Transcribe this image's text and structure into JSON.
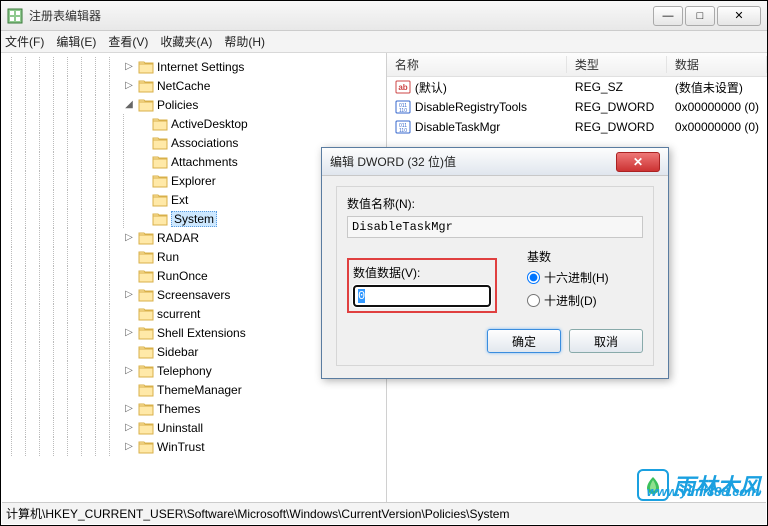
{
  "window": {
    "title": "注册表编辑器",
    "min": "—",
    "max": "□",
    "close": "✕"
  },
  "menu": {
    "file": "文件(F)",
    "edit": "编辑(E)",
    "view": "查看(V)",
    "favorites": "收藏夹(A)",
    "help": "帮助(H)"
  },
  "tree": {
    "items": [
      {
        "label": "Internet Settings",
        "depth": 8,
        "toggle": "▷"
      },
      {
        "label": "NetCache",
        "depth": 8,
        "toggle": "▷"
      },
      {
        "label": "Policies",
        "depth": 8,
        "toggle": "◢"
      },
      {
        "label": "ActiveDesktop",
        "depth": 9
      },
      {
        "label": "Associations",
        "depth": 9
      },
      {
        "label": "Attachments",
        "depth": 9
      },
      {
        "label": "Explorer",
        "depth": 9
      },
      {
        "label": "Ext",
        "depth": 9
      },
      {
        "label": "System",
        "depth": 9,
        "selected": true
      },
      {
        "label": "RADAR",
        "depth": 8,
        "toggle": "▷"
      },
      {
        "label": "Run",
        "depth": 8
      },
      {
        "label": "RunOnce",
        "depth": 8
      },
      {
        "label": "Screensavers",
        "depth": 8,
        "toggle": "▷"
      },
      {
        "label": "scurrent",
        "depth": 8
      },
      {
        "label": "Shell Extensions",
        "depth": 8,
        "toggle": "▷"
      },
      {
        "label": "Sidebar",
        "depth": 8
      },
      {
        "label": "Telephony",
        "depth": 8,
        "toggle": "▷"
      },
      {
        "label": "ThemeManager",
        "depth": 8
      },
      {
        "label": "Themes",
        "depth": 8,
        "toggle": "▷"
      },
      {
        "label": "Uninstall",
        "depth": 8,
        "toggle": "▷"
      },
      {
        "label": "WinTrust",
        "depth": 8,
        "toggle": "▷"
      }
    ]
  },
  "list": {
    "headers": {
      "name": "名称",
      "type": "类型",
      "data": "数据"
    },
    "rows": [
      {
        "icon": "string",
        "name": "(默认)",
        "type": "REG_SZ",
        "data": "(数值未设置)"
      },
      {
        "icon": "binary",
        "name": "DisableRegistryTools",
        "type": "REG_DWORD",
        "data": "0x00000000 (0)"
      },
      {
        "icon": "binary",
        "name": "DisableTaskMgr",
        "type": "REG_DWORD",
        "data": "0x00000000 (0)"
      }
    ]
  },
  "dialog": {
    "title": "编辑 DWORD (32 位)值",
    "name_label": "数值名称(N):",
    "name_value": "DisableTaskMgr",
    "data_label": "数值数据(V):",
    "data_value": "0",
    "base_label": "基数",
    "hex_label": "十六进制(H)",
    "dec_label": "十进制(D)",
    "ok": "确定",
    "cancel": "取消",
    "close": "✕"
  },
  "statusbar": {
    "path": "计算机\\HKEY_CURRENT_USER\\Software\\Microsoft\\Windows\\CurrentVersion\\Policies\\System"
  },
  "watermark": {
    "text": "雨林木风",
    "url": "www.ylmf888.com"
  }
}
